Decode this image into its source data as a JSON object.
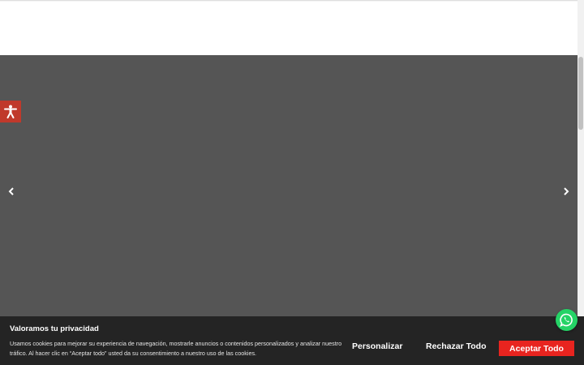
{
  "cookie_banner": {
    "title": "Valoramos tu privacidad",
    "description": "Usamos cookies para mejorar su experiencia de navegación, mostrarle anuncios o contenidos personalizados y analizar nuestro tráfico. Al hacer clic en “Aceptar todo” usted da su consentimiento a nuestro uso de las cookies.",
    "buttons": {
      "customize": "Personalizar",
      "reject_all": "Rechazar Todo",
      "accept_all": "Aceptar Todo"
    }
  },
  "colors": {
    "slider_background": "#555555",
    "banner_background": "#242424",
    "accept_button": "#e8241f",
    "accessibility_button": "#c0392b",
    "whatsapp_button": "#25d366"
  },
  "icons": {
    "accessibility": "accessibility-icon",
    "slider_prev": "chevron-left-icon",
    "slider_next": "chevron-right-icon",
    "whatsapp": "whatsapp-icon"
  }
}
